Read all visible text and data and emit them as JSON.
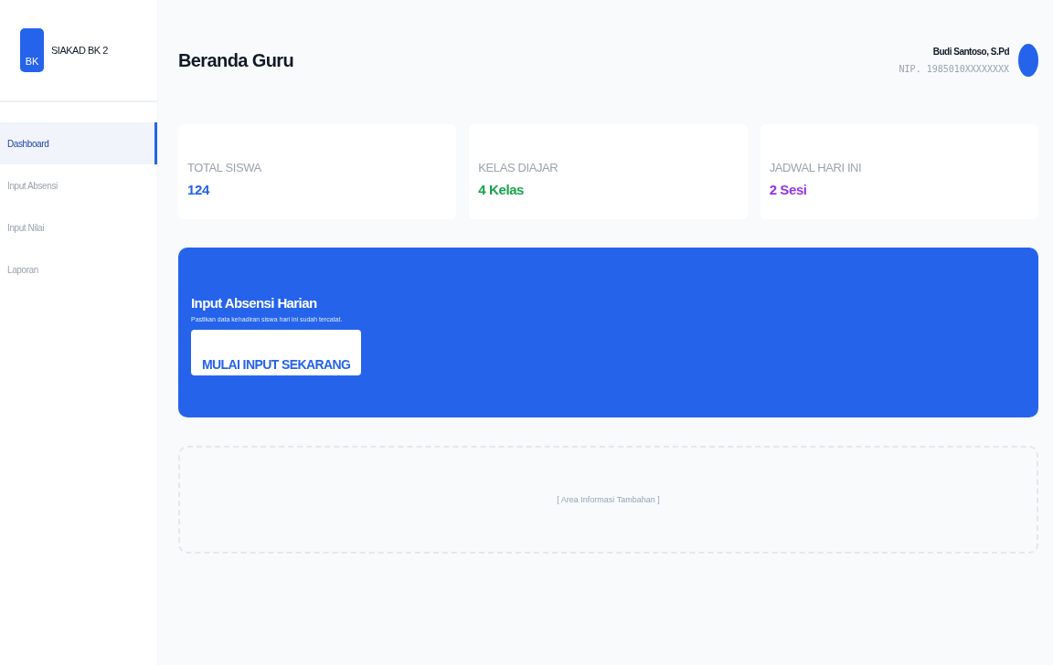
{
  "sidebar": {
    "logo_badge": "BK",
    "app_name": "SIAKAD BK 2",
    "items": [
      {
        "label": "Dashboard",
        "selected": true
      },
      {
        "label": "Input Absensi",
        "selected": false
      },
      {
        "label": "Input Nilai",
        "selected": false
      },
      {
        "label": "Laporan",
        "selected": false
      }
    ]
  },
  "header": {
    "title": "Beranda Guru",
    "user_name": "Budi Santoso, S.Pd",
    "user_id": "NIP. 1985010XXXXXXXX"
  },
  "stats": [
    {
      "label": "TOTAL SISWA",
      "value": "124",
      "color": "#2563eb"
    },
    {
      "label": "KELAS DIAJAR",
      "value": "4 Kelas",
      "color": "#16a34a"
    },
    {
      "label": "JADWAL HARI INI",
      "value": "2 Sesi",
      "color": "#9333ea"
    }
  ],
  "banner": {
    "title": "Input Absensi Harian",
    "subtitle": "Pastikan data kehadiran siswa hari ini sudah tercatat.",
    "button": "MULAI INPUT SEKARANG"
  },
  "placeholder_panel": {
    "text": "[ Area Informasi Tambahan ]"
  }
}
